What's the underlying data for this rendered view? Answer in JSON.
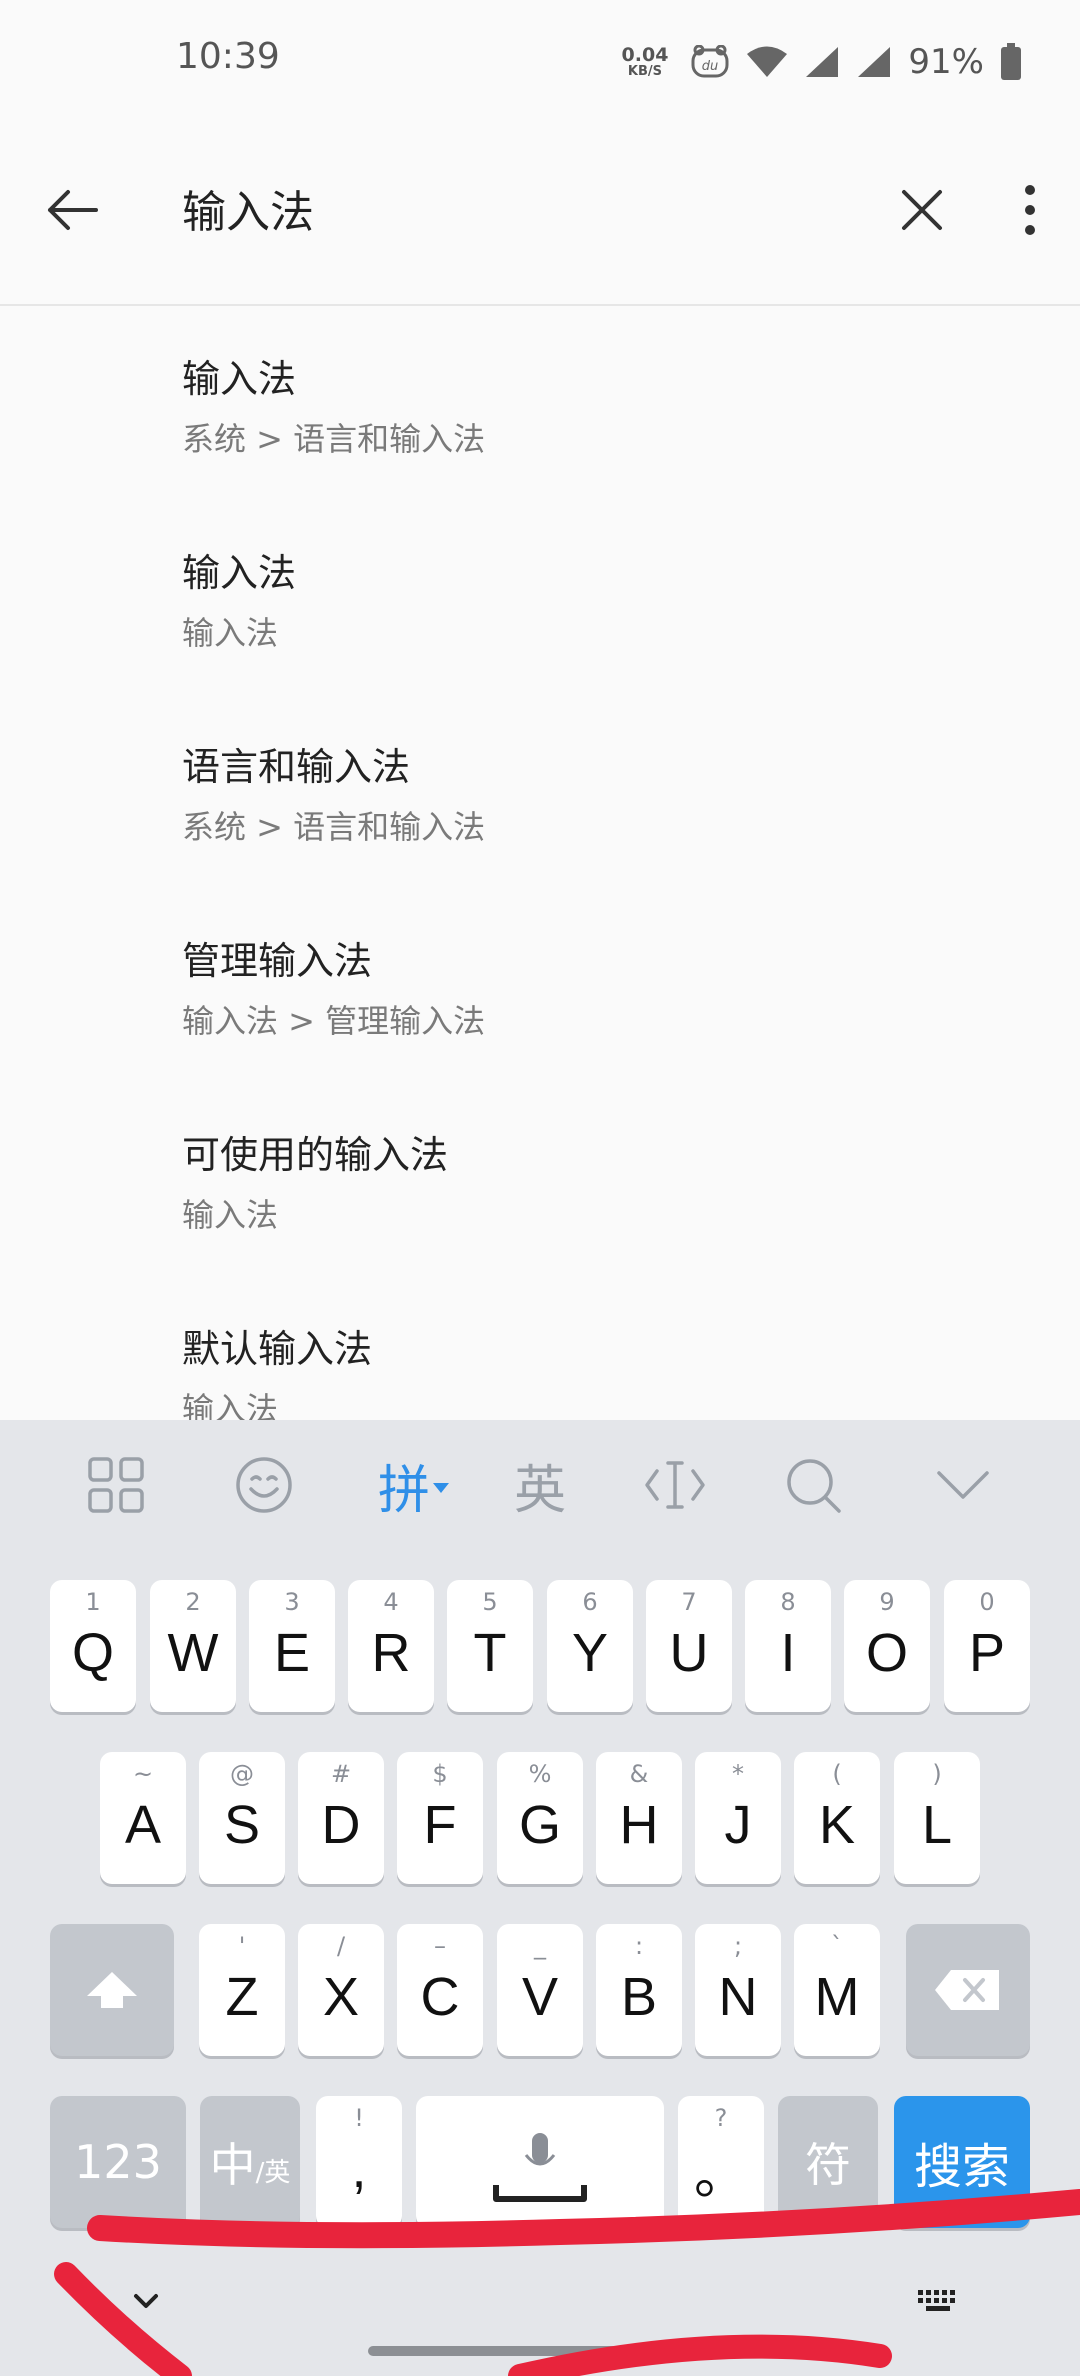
{
  "status_bar": {
    "time": "10:39",
    "net_speed_value": "0.04",
    "net_speed_unit": "KB/S",
    "battery_percent": "91%",
    "icons": [
      "du-app-icon",
      "wifi-icon",
      "signal-icon",
      "signal-icon",
      "battery-icon"
    ]
  },
  "app_bar": {
    "search_query": "输入法",
    "icons": [
      "back-arrow-icon",
      "close-icon",
      "more-vert-icon"
    ]
  },
  "results": [
    {
      "title": "输入法",
      "subtitle": "系统 > 语言和输入法"
    },
    {
      "title": "输入法",
      "subtitle": "输入法"
    },
    {
      "title": "语言和输入法",
      "subtitle": "系统 > 语言和输入法"
    },
    {
      "title": "管理输入法",
      "subtitle": "输入法 > 管理输入法"
    },
    {
      "title": "可使用的输入法",
      "subtitle": "输入法"
    },
    {
      "title": "默认输入法",
      "subtitle": "输入法"
    }
  ],
  "keyboard": {
    "toolbar": {
      "pinyin": "拼",
      "english": "英",
      "icons": [
        "apps-grid-icon",
        "emoji-icon",
        "dropdown-triangle-icon",
        "cursor-icon",
        "search-icon",
        "collapse-chevron-icon"
      ]
    },
    "row1": [
      {
        "key": "Q",
        "hint": "1"
      },
      {
        "key": "W",
        "hint": "2"
      },
      {
        "key": "E",
        "hint": "3"
      },
      {
        "key": "R",
        "hint": "4"
      },
      {
        "key": "T",
        "hint": "5"
      },
      {
        "key": "Y",
        "hint": "6"
      },
      {
        "key": "U",
        "hint": "7"
      },
      {
        "key": "I",
        "hint": "8"
      },
      {
        "key": "O",
        "hint": "9"
      },
      {
        "key": "P",
        "hint": "0"
      }
    ],
    "row2": [
      {
        "key": "A",
        "hint": "~"
      },
      {
        "key": "S",
        "hint": "@"
      },
      {
        "key": "D",
        "hint": "#"
      },
      {
        "key": "F",
        "hint": "$"
      },
      {
        "key": "G",
        "hint": "%"
      },
      {
        "key": "H",
        "hint": "&"
      },
      {
        "key": "J",
        "hint": "*"
      },
      {
        "key": "K",
        "hint": "("
      },
      {
        "key": "L",
        "hint": ")"
      }
    ],
    "row3": [
      {
        "key": "Z",
        "hint": "'"
      },
      {
        "key": "X",
        "hint": "/"
      },
      {
        "key": "C",
        "hint": "–"
      },
      {
        "key": "V",
        "hint": "_"
      },
      {
        "key": "B",
        "hint": ":"
      },
      {
        "key": "N",
        "hint": ";"
      },
      {
        "key": "M",
        "hint": "`"
      }
    ],
    "row4": {
      "num": "123",
      "zh": "中",
      "zh_alt": "/英",
      "comma": ",",
      "comma_hint": "!",
      "period": "。",
      "period_hint": "?",
      "symbol": "符",
      "search": "搜索"
    },
    "bottom_icons": [
      "chevron-down-icon",
      "keyboard-icon"
    ]
  }
}
